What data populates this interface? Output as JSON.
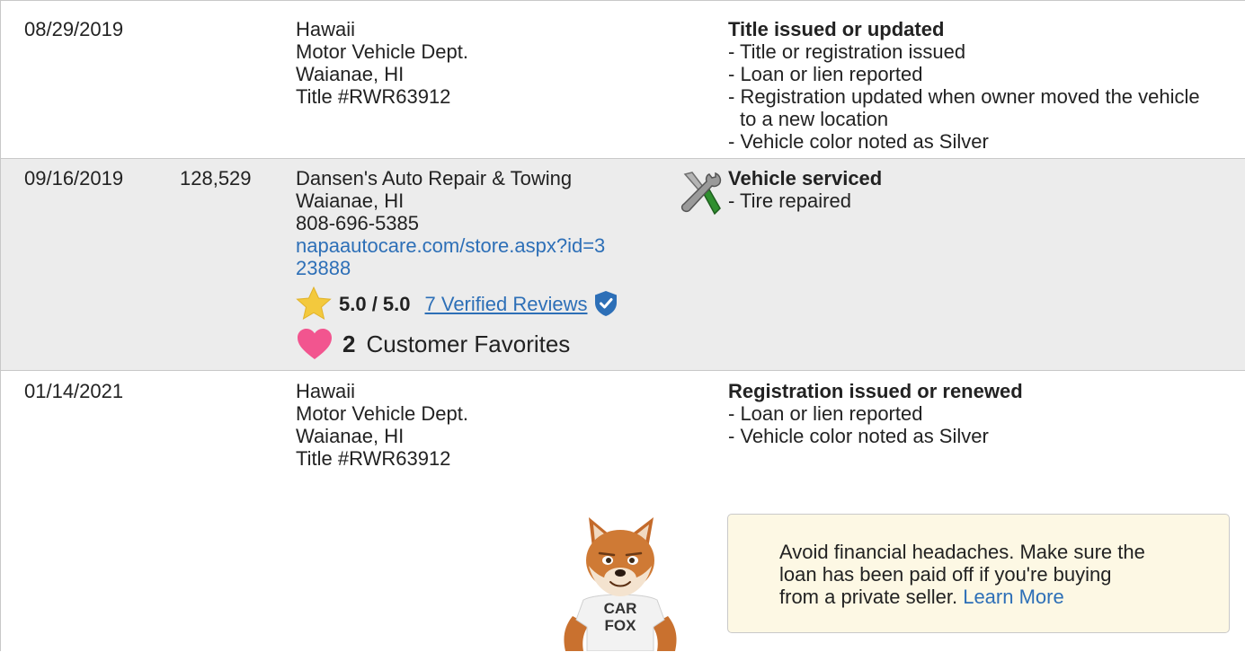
{
  "records": [
    {
      "date": "08/29/2019",
      "odometer": "",
      "source": [
        "Hawaii",
        "Motor Vehicle Dept.",
        "Waianae, HI",
        "Title #RWR63912"
      ],
      "comment_title": "Title issued or updated",
      "comments": [
        "- Title or registration issued",
        "- Loan or lien reported",
        "- Registration updated when owner moved the vehicle",
        "to a new location",
        "- Vehicle color noted as Silver"
      ]
    },
    {
      "date": "09/16/2019",
      "odometer": "128,529",
      "source": [
        "Dansen's Auto Repair & Towing",
        "Waianae, HI",
        "808-696-5385"
      ],
      "source_link_lines": [
        "napaautocare.com/store.aspx?id=3",
        "23888"
      ],
      "rating": "5.0 / 5.0",
      "reviews_link": "7 Verified Reviews",
      "favorites_count": "2",
      "favorites_label": "Customer Favorites",
      "comment_icon": "service-tools-icon",
      "comment_title": "Vehicle serviced",
      "comments": [
        "- Tire repaired"
      ]
    },
    {
      "date": "01/14/2021",
      "odometer": "",
      "source": [
        "Hawaii",
        "Motor Vehicle Dept.",
        "Waianae, HI",
        "Title #RWR63912"
      ],
      "comment_title": "Registration issued or renewed",
      "comments": [
        "- Loan or lien reported",
        "- Vehicle color noted as Silver"
      ]
    }
  ],
  "tip": {
    "lines": [
      "Avoid financial headaches. Make sure the",
      "loan has been paid off if you're buying",
      "from a private seller."
    ],
    "link": "Learn More"
  },
  "mascot": {
    "shirt_text": [
      "CAR",
      "FOX"
    ]
  },
  "colors": {
    "link": "#2d6fb7",
    "alt_row": "#ececec",
    "tip_bg": "#fdf8e4",
    "heart": "#f2558f",
    "star": "#f3c93d",
    "verified": "#2d6fb7"
  }
}
